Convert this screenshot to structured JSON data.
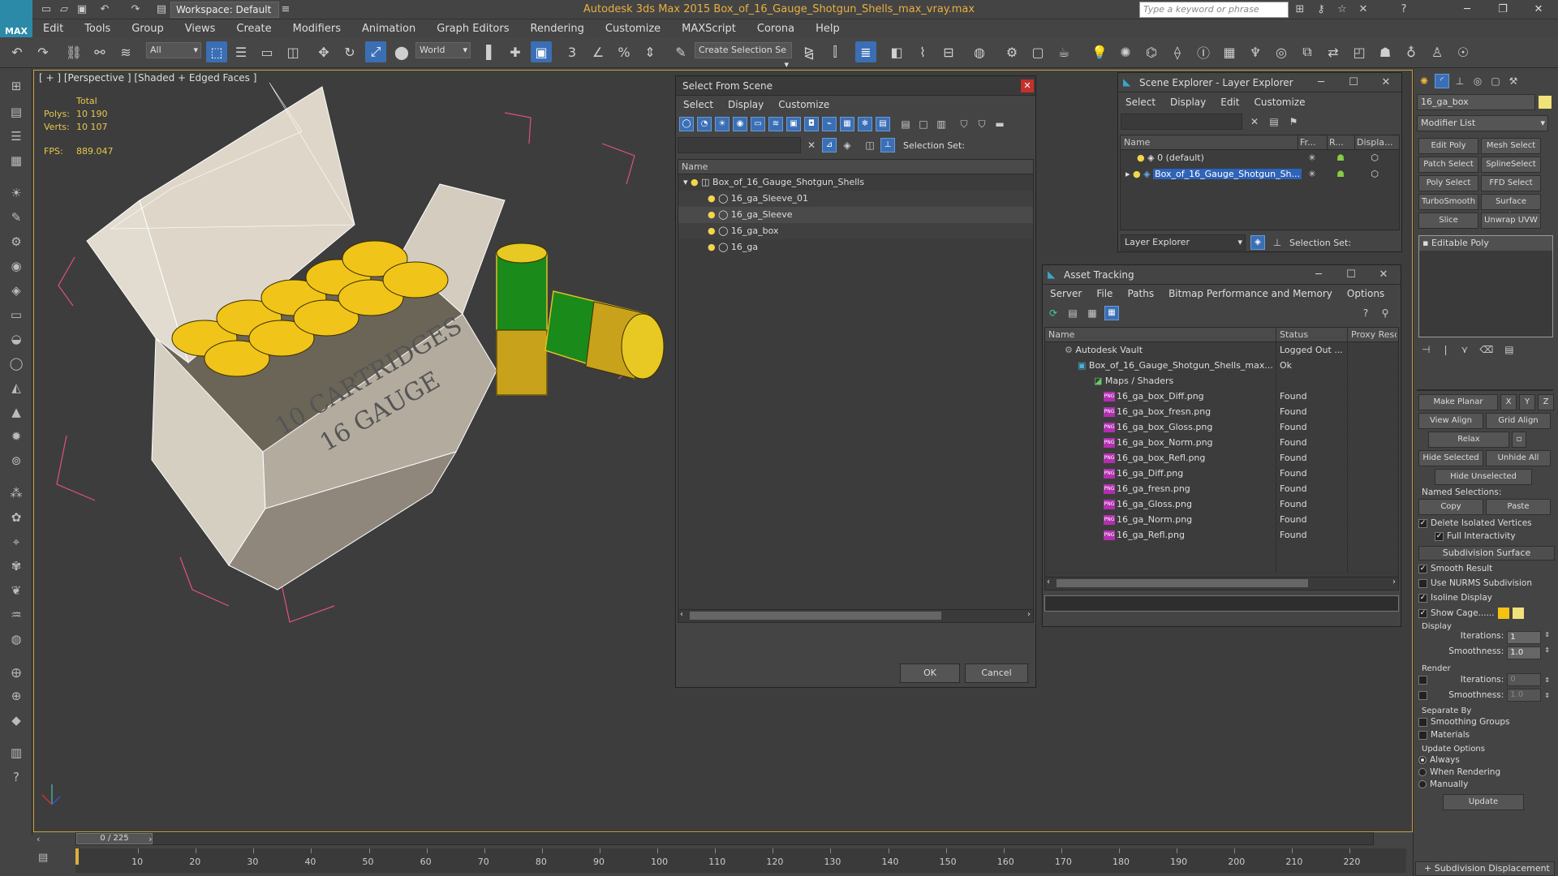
{
  "app": {
    "title": "Autodesk 3ds Max  2015      Box_of_16_Gauge_Shotgun_Shells_max_vray.max",
    "workspace": "Workspace: Default",
    "search_placeholder": "Type a keyword or phrase",
    "logo": "MAX"
  },
  "menu": [
    "Edit",
    "Tools",
    "Group",
    "Views",
    "Create",
    "Modifiers",
    "Animation",
    "Graph Editors",
    "Rendering",
    "Customize",
    "MAXScript",
    "Corona",
    "Help"
  ],
  "toolbar": {
    "filter": "All",
    "coord": "World",
    "selection_set": "Create Selection Se"
  },
  "viewport": {
    "label": "[ + ] [Perspective ] [Shaded + Edged Faces ]",
    "stats_total": "Total",
    "polys_label": "Polys:",
    "polys_value": "10 190",
    "verts_label": "Verts:",
    "verts_value": "10 107",
    "fps_label": "FPS:",
    "fps_value": "889.047",
    "box_text_1": "10 CARTRIDGES",
    "box_text_2": "16 GAUGE"
  },
  "select_from_scene": {
    "title": "Select From Scene",
    "menu": [
      "Select",
      "Display",
      "Customize"
    ],
    "selection_set_label": "Selection Set:",
    "col_name": "Name",
    "root": "Box_of_16_Gauge_Shotgun_Shells",
    "children": [
      "16_ga_Sleeve_01",
      "16_ga_Sleeve",
      "16_ga_box",
      "16_ga"
    ],
    "ok": "OK",
    "cancel": "Cancel"
  },
  "scene_explorer": {
    "title": "Scene Explorer - Layer Explorer",
    "menu": [
      "Select",
      "Display",
      "Edit",
      "Customize"
    ],
    "col_name": "Name",
    "col_fr": "Fr...",
    "col_r": "R...",
    "col_disp": "Displa...",
    "rows": [
      "0 (default)",
      "Box_of_16_Gauge_Shotgun_Sh..."
    ],
    "footer_dropdown": "Layer Explorer",
    "selection_set_label": "Selection Set:"
  },
  "asset_tracking": {
    "title": "Asset Tracking",
    "menu": [
      "Server",
      "File",
      "Paths",
      "Bitmap Performance and Memory",
      "Options"
    ],
    "col_name": "Name",
    "col_status": "Status",
    "col_proxy": "Proxy Reso",
    "rows": [
      {
        "name": "Autodesk Vault",
        "status": "Logged Out ...",
        "indent": 1,
        "kind": "vault"
      },
      {
        "name": "Box_of_16_Gauge_Shotgun_Shells_max...",
        "status": "Ok",
        "indent": 2,
        "kind": "max"
      },
      {
        "name": "Maps / Shaders",
        "status": "",
        "indent": 3,
        "kind": "folder"
      },
      {
        "name": "16_ga_box_Diff.png",
        "status": "Found",
        "indent": 4,
        "kind": "png"
      },
      {
        "name": "16_ga_box_fresn.png",
        "status": "Found",
        "indent": 4,
        "kind": "png"
      },
      {
        "name": "16_ga_box_Gloss.png",
        "status": "Found",
        "indent": 4,
        "kind": "png"
      },
      {
        "name": "16_ga_box_Norm.png",
        "status": "Found",
        "indent": 4,
        "kind": "png"
      },
      {
        "name": "16_ga_box_Refl.png",
        "status": "Found",
        "indent": 4,
        "kind": "png"
      },
      {
        "name": "16_ga_Diff.png",
        "status": "Found",
        "indent": 4,
        "kind": "png"
      },
      {
        "name": "16_ga_fresn.png",
        "status": "Found",
        "indent": 4,
        "kind": "png"
      },
      {
        "name": "16_ga_Gloss.png",
        "status": "Found",
        "indent": 4,
        "kind": "png"
      },
      {
        "name": "16_ga_Norm.png",
        "status": "Found",
        "indent": 4,
        "kind": "png"
      },
      {
        "name": "16_ga_Refl.png",
        "status": "Found",
        "indent": 4,
        "kind": "png"
      }
    ],
    "png_badge": "PNG"
  },
  "command_panel": {
    "object_name": "16_ga_box",
    "modifier_list": "Modifier List",
    "quick_buttons": [
      "Edit Poly",
      "Mesh Select",
      "Patch Select",
      "SplineSelect",
      "Poly Select",
      "FFD Select",
      "TurboSmooth",
      "Surface Select",
      "Slice",
      "Unwrap UVW"
    ],
    "stack_item": "Editable Poly",
    "make_planar": "Make Planar",
    "x": "X",
    "y": "Y",
    "z": "Z",
    "view_align": "View Align",
    "grid_align": "Grid Align",
    "relax": "Relax",
    "hide_selected": "Hide Selected",
    "unhide_all": "Unhide All",
    "hide_unselected": "Hide Unselected",
    "named_selections": "Named Selections:",
    "copy": "Copy",
    "paste": "Paste",
    "delete_isolated": "Delete Isolated Vertices",
    "full_interactivity": "Full Interactivity",
    "subdivision_surface": "Subdivision Surface",
    "smooth_result": "Smooth Result",
    "use_nurms": "Use NURMS Subdivision",
    "isoline_display": "Isoline Display",
    "show_cage": "Show Cage......",
    "display_group": "Display",
    "iterations_label": "Iterations:",
    "iterations_value": "1",
    "smoothness_label": "Smoothness:",
    "smoothness_value": "1.0",
    "render_group": "Render",
    "r_iterations_value": "0",
    "r_smoothness_value": "1.0",
    "separate_by": "Separate By",
    "smoothing_groups": "Smoothing Groups",
    "materials": "Materials",
    "update_options": "Update Options",
    "always": "Always",
    "when_rendering": "When Rendering",
    "manually": "Manually",
    "update": "Update",
    "subdivision_displacement": "Subdivision Displacement",
    "cage_color_1": "#f5c211",
    "cage_color_2": "#f2e27a"
  },
  "timeline": {
    "frame": "0 / 225",
    "ticks": [
      10,
      20,
      30,
      40,
      50,
      60,
      70,
      80,
      90,
      100,
      110,
      120,
      130,
      140,
      150,
      160,
      170,
      180,
      190,
      200,
      210,
      220
    ]
  }
}
